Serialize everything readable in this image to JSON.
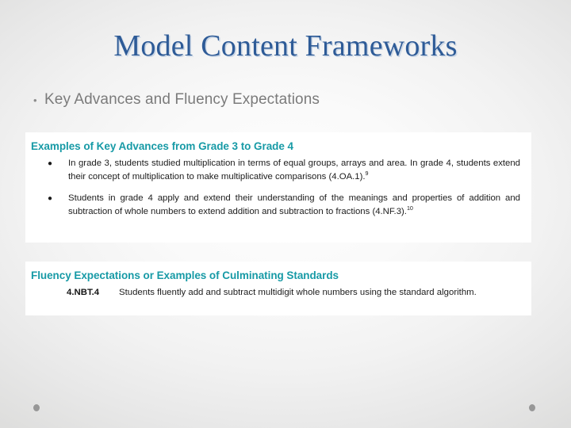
{
  "slide": {
    "title": "Model Content Frameworks",
    "outline_bullet_glyph": "•",
    "outline_item": "Key Advances and Fluency Expectations",
    "title_color": "#2E5B97",
    "heading_color": "#179AA6",
    "outline_text_color": "#7B7B7B",
    "panel_background": "#FFFFFF",
    "slide_background": "#F2F2F2"
  },
  "panels": [
    {
      "heading": "Examples of Key Advances from Grade 3 to Grade 4",
      "bullet_glyph": "●",
      "items": [
        {
          "text": "In grade 3, students studied multiplication in terms of equal groups, arrays and area. In grade 4, students extend their concept of multiplication to make multiplicative comparisons (4.OA.1).",
          "footnote": "9"
        },
        {
          "text": "Students in grade 4 apply and extend their understanding of the meanings and properties of addition and subtraction of whole numbers to extend addition and subtraction to fractions (4.NF.3).",
          "footnote": "10"
        }
      ]
    },
    {
      "heading": "Fluency Expectations or Examples of Culminating Standards",
      "standard_code": "4.NBT.4",
      "standard_text": "Students fluently add and subtract multidigit whole numbers using the standard algorithm."
    }
  ]
}
